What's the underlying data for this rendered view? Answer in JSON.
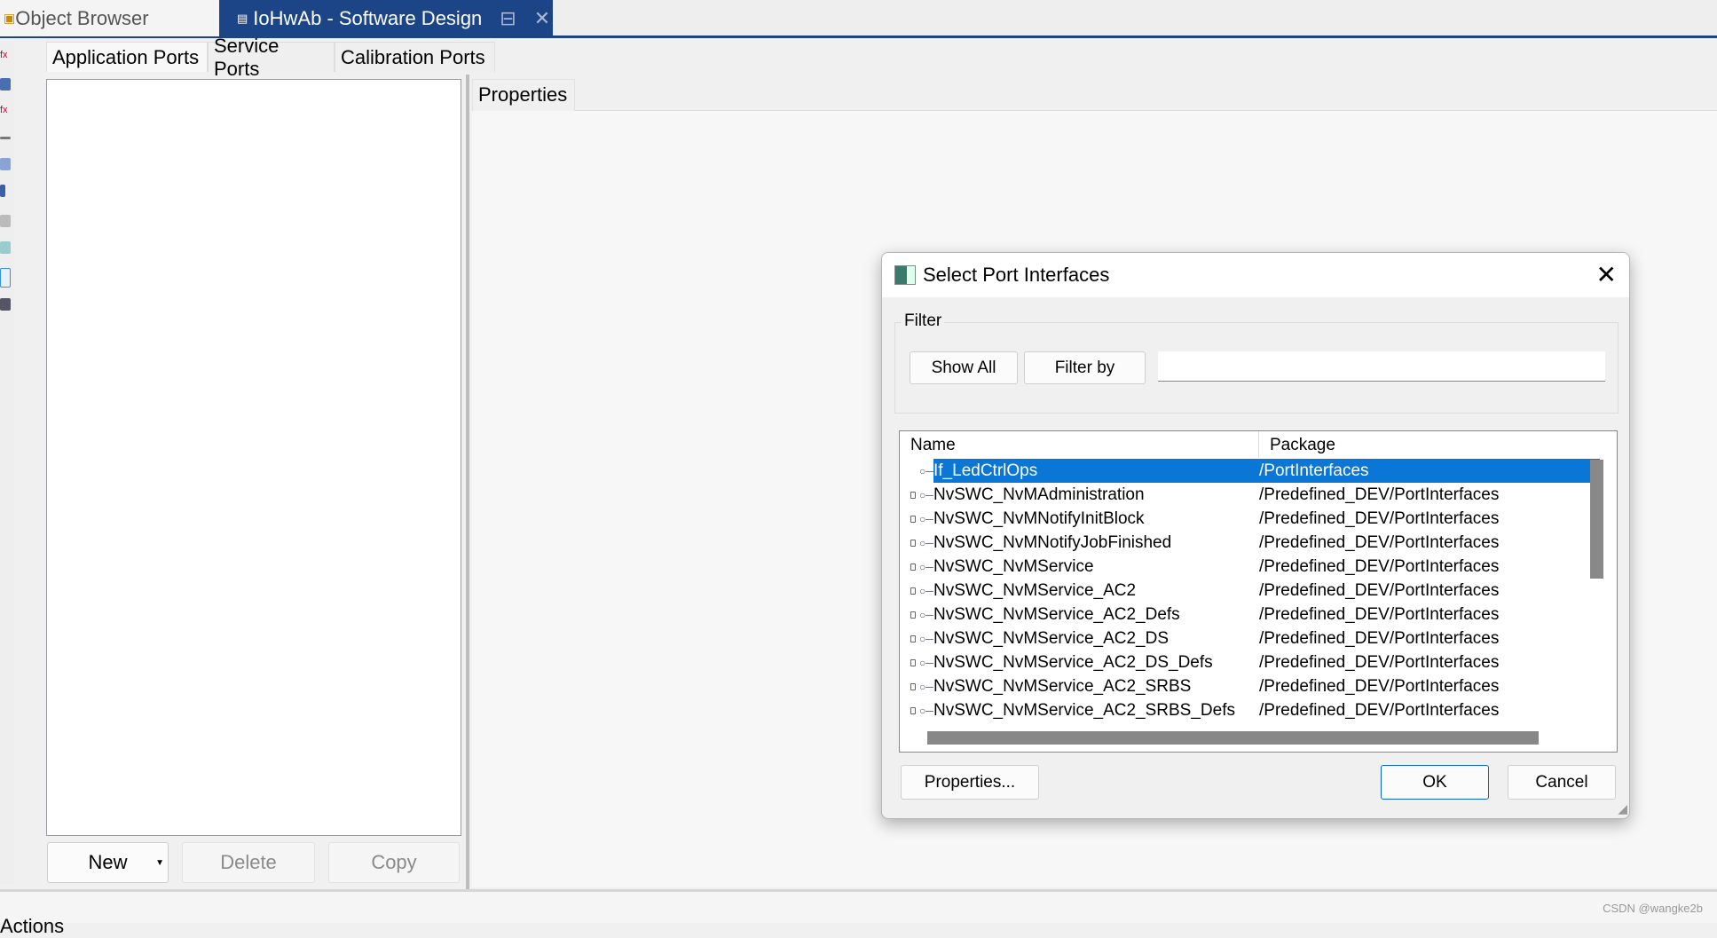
{
  "tabs": {
    "object_browser": "Object Browser",
    "software_design": "IoHwAb - Software Design"
  },
  "subtabs": [
    "Application Ports",
    "Service Ports",
    "Calibration Ports"
  ],
  "left_buttons": {
    "new": "New",
    "delete": "Delete",
    "copy": "Copy"
  },
  "properties_tab": "Properties",
  "bottom_panel": "Actions",
  "dialog": {
    "title": "Select Port Interfaces",
    "filter_label": "Filter",
    "show_all": "Show All",
    "filter_by": "Filter by",
    "filter_value": "",
    "columns": [
      "Name",
      "Package"
    ],
    "rows": [
      {
        "name": "If_LedCtrlOps",
        "package": "/PortInterfaces",
        "selected": true,
        "locked": false
      },
      {
        "name": "NvSWC_NvMAdministration",
        "package": "/Predefined_DEV/PortInterfaces",
        "locked": true
      },
      {
        "name": "NvSWC_NvMNotifyInitBlock",
        "package": "/Predefined_DEV/PortInterfaces",
        "locked": true
      },
      {
        "name": "NvSWC_NvMNotifyJobFinished",
        "package": "/Predefined_DEV/PortInterfaces",
        "locked": true
      },
      {
        "name": "NvSWC_NvMService",
        "package": "/Predefined_DEV/PortInterfaces",
        "locked": true
      },
      {
        "name": "NvSWC_NvMService_AC2",
        "package": "/Predefined_DEV/PortInterfaces",
        "locked": true
      },
      {
        "name": "NvSWC_NvMService_AC2_Defs",
        "package": "/Predefined_DEV/PortInterfaces",
        "locked": true
      },
      {
        "name": "NvSWC_NvMService_AC2_DS",
        "package": "/Predefined_DEV/PortInterfaces",
        "locked": true
      },
      {
        "name": "NvSWC_NvMService_AC2_DS_Defs",
        "package": "/Predefined_DEV/PortInterfaces",
        "locked": true
      },
      {
        "name": "NvSWC_NvMService_AC2_SRBS",
        "package": "/Predefined_DEV/PortInterfaces",
        "locked": true
      },
      {
        "name": "NvSWC_NvMService_AC2_SRBS_Defs",
        "package": "/Predefined_DEV/PortInterfaces",
        "locked": true
      }
    ],
    "properties_button": "Properties...",
    "ok": "OK",
    "cancel": "Cancel"
  },
  "watermark": "CSDN @wangke2b",
  "colors": {
    "active_tab": "#1c4587",
    "selection": "#0a77d6"
  }
}
